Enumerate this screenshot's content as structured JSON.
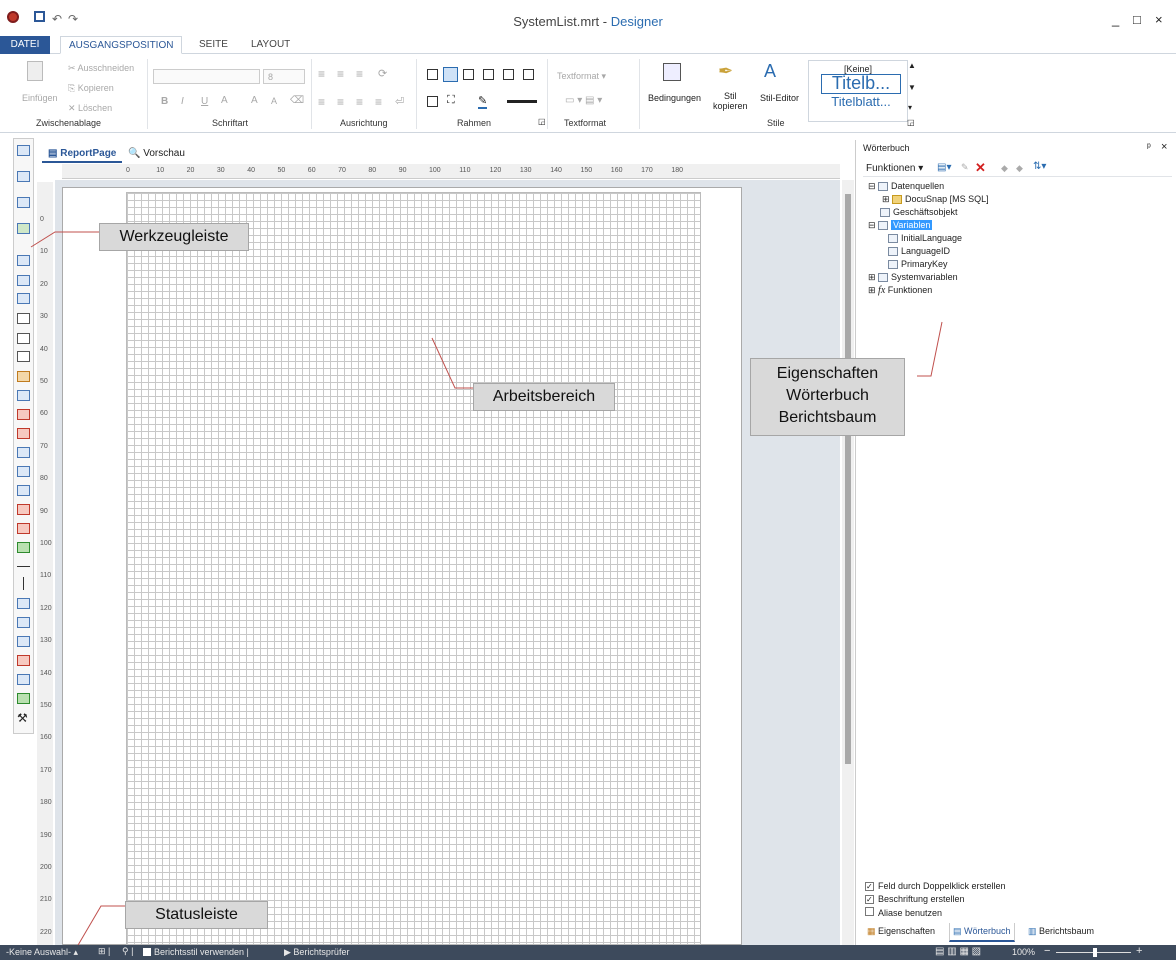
{
  "window": {
    "file": "SystemList.mrt",
    "separator": " - ",
    "app": "Designer",
    "min": "_",
    "max": "□",
    "close": "×"
  },
  "qat": {
    "undo": "↶",
    "redo": "↷"
  },
  "ribbon_tabs": [
    "DATEI",
    "AUSGANGSPOSITION",
    "SEITE",
    "LAYOUT"
  ],
  "clipboard": {
    "paste": "Einfügen",
    "cut": "Ausschneiden",
    "copy": "Kopieren",
    "delete": "Löschen",
    "label": "Zwischenablage"
  },
  "font": {
    "size": "8",
    "bold": "B",
    "italic": "I",
    "underline": "U",
    "color": "A",
    "grow": "A",
    "shrink": "A",
    "label": "Schriftart"
  },
  "alignment": {
    "label": "Ausrichtung"
  },
  "borders": {
    "label": "Rahmen"
  },
  "textformat": {
    "dropdown": "Textformat",
    "label": "Textformat"
  },
  "styles": {
    "conditions": "Bedingungen",
    "copy_style_1": "Stil",
    "copy_style_2": "kopieren",
    "style_editor": "Stil-Editor",
    "none": "[Keine]",
    "sample1": "Titelb...",
    "sample2": "Titelblatt...",
    "label": "Stile"
  },
  "doc_tabs": {
    "report_page": "ReportPage",
    "preview": "Vorschau"
  },
  "ruler": {
    "h": [
      "0",
      "10",
      "20",
      "30",
      "40",
      "50",
      "60",
      "70",
      "80",
      "90",
      "100",
      "110",
      "120",
      "130",
      "140",
      "150",
      "160",
      "170",
      "180"
    ],
    "v": [
      "0",
      "10",
      "20",
      "30",
      "40",
      "50",
      "60",
      "70",
      "80",
      "90",
      "100",
      "110",
      "120",
      "130",
      "140",
      "150",
      "160",
      "170",
      "180",
      "190",
      "200",
      "210",
      "220"
    ]
  },
  "dictionary": {
    "title": "Wörterbuch",
    "pin": "ᵖ",
    "close": "×",
    "functions_menu": "Funktionen",
    "tree": {
      "datasources": "Datenquellen",
      "docusnap": "DocuSnap [MS SQL]",
      "business": "Geschäftsobjekt",
      "variables": "Variablen",
      "initlang": "InitialLanguage",
      "langid": "LanguageID",
      "primarykey": "PrimaryKey",
      "sysvars": "Systemvariablen",
      "functions": "Funktionen",
      "fx": "fx"
    },
    "options": {
      "dblclick": "Feld durch Doppelklick erstellen",
      "caption": "Beschriftung erstellen",
      "aliases": "Aliase benutzen",
      "check": "✓"
    },
    "bottom_tabs": {
      "properties": "Eigenschaften",
      "dictionary": "Wörterbuch",
      "report_tree": "Berichtsbaum"
    }
  },
  "callouts": {
    "toolbar": "Werkzeugleiste",
    "workspace": "Arbeitsbereich",
    "panels_1": "Eigenschaften",
    "panels_2": "Wörterbuch",
    "panels_3": "Berichtsbaum",
    "statusbar": "Statusleiste"
  },
  "statusbar": {
    "selection": "-Keine Auswahl-",
    "style": "Berichtsstil verwenden",
    "checker": "Berichtsprüfer",
    "zoom": "100%"
  },
  "colors": {
    "accent": "#2b5797",
    "status": "#3d4a5c",
    "callout": "#d9d9d9",
    "leader": "#c0504d"
  }
}
